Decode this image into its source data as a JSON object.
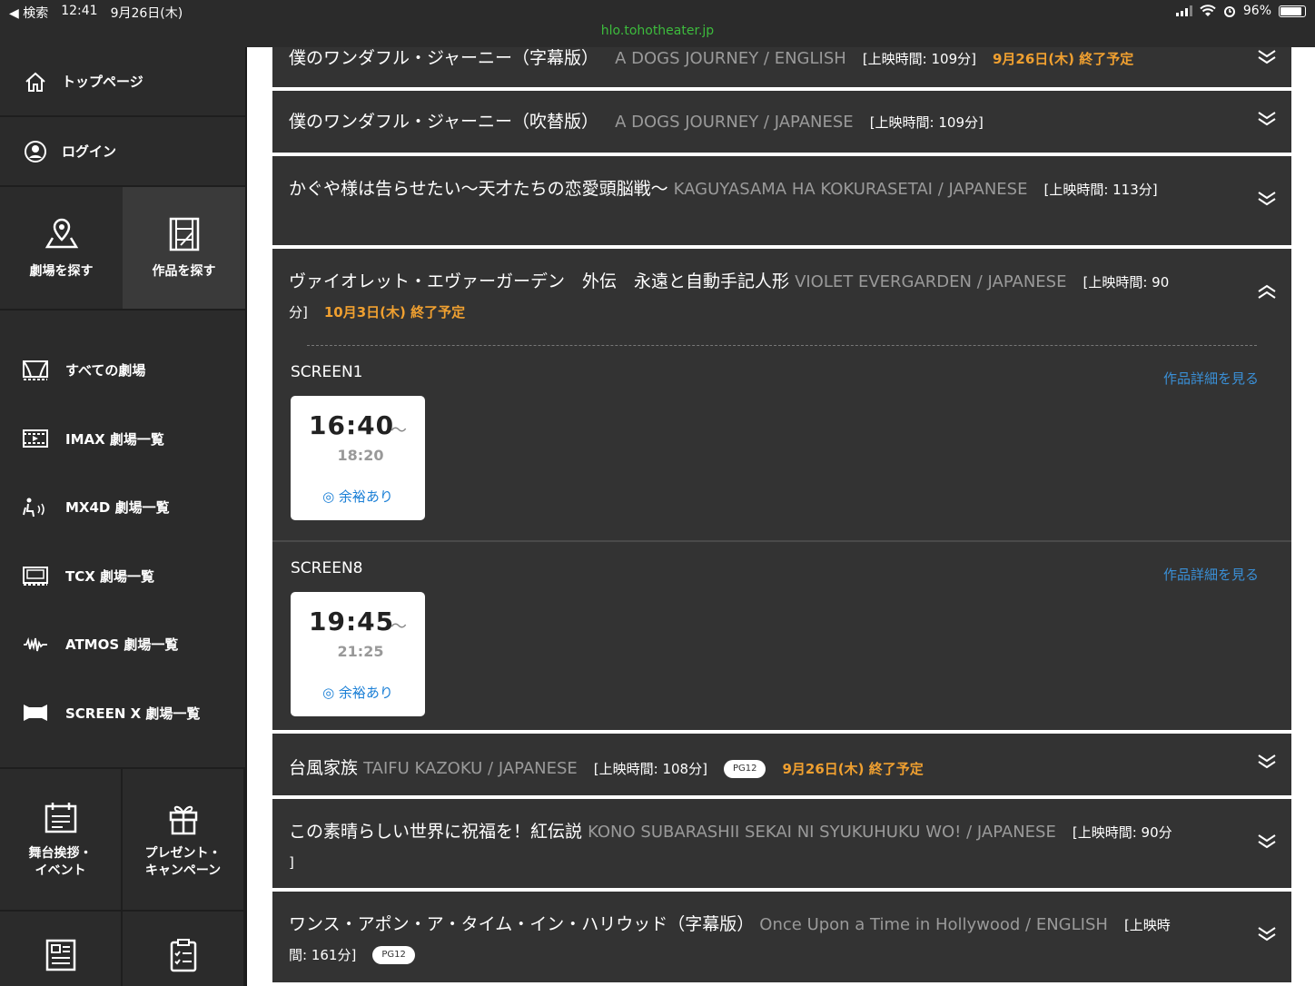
{
  "status": {
    "back": "◀ 検索",
    "time": "12:41",
    "date": "9月26日(木)",
    "battery": "96%",
    "url": "hlo.tohotheater.jp"
  },
  "sidebar": {
    "top_page": "トップページ",
    "login": "ログイン",
    "find_theater": "劇場を探す",
    "find_movie": "作品を探す",
    "items": [
      {
        "label": "すべての劇場",
        "icon": "theater-icon"
      },
      {
        "label": "IMAX 劇場一覧",
        "icon": "imax-icon"
      },
      {
        "label": "MX4D 劇場一覧",
        "icon": "mx4d-icon"
      },
      {
        "label": "TCX 劇場一覧",
        "icon": "tcx-icon"
      },
      {
        "label": "ATMOS 劇場一覧",
        "icon": "atmos-icon"
      },
      {
        "label": "SCREEN X 劇場一覧",
        "icon": "screenx-icon"
      }
    ],
    "event_line1": "舞台挨拶・",
    "event_line2": "イベント",
    "present_line1": "プレゼント・",
    "present_line2": "キャンペーン"
  },
  "movies": [
    {
      "jp": "僕のワンダフル・ジャーニー（字幕版）",
      "en": "A DOGS JOURNEY / ENGLISH",
      "duration": "[上映時間: 109分]",
      "end": "9月26日(木) 終了予定"
    },
    {
      "jp": "僕のワンダフル・ジャーニー（吹替版）",
      "en": "A DOGS JOURNEY / JAPANESE",
      "duration": "[上映時間: 109分]"
    },
    {
      "jp": "かぐや様は告らせたい〜天才たちの恋愛頭脳戦〜",
      "en": "KAGUYASAMA HA KOKURASETAI / JAPANESE",
      "duration": "[上映時間: 113分]"
    },
    {
      "jp": "ヴァイオレット・エヴァーガーデン　外伝　永遠と自動手記人形",
      "en": "VIOLET EVERGARDEN / JAPANESE",
      "duration_a": "[上映時間: 90",
      "duration_b": "分]",
      "end": "10月3日(木) 終了予定",
      "screens": [
        {
          "name": "SCREEN1",
          "start": "16:40",
          "tilde": "〜",
          "finish": "18:20",
          "avail": "◎ 余裕あり",
          "link": "作品詳細を見る"
        },
        {
          "name": "SCREEN8",
          "start": "19:45",
          "tilde": "〜",
          "finish": "21:25",
          "avail": "◎ 余裕あり",
          "link": "作品詳細を見る"
        }
      ]
    },
    {
      "jp": "台風家族",
      "en": "TAIFU KAZOKU / JAPANESE",
      "duration": "[上映時間: 108分]",
      "rating": "PG12",
      "end": "9月26日(木) 終了予定"
    },
    {
      "jp": "この素晴らしい世界に祝福を！紅伝説",
      "en": "KONO SUBARASHII SEKAI NI SYUKUHUKU WO! / JAPANESE",
      "duration_a": "[上映時間: 90分",
      "duration_b": "]"
    },
    {
      "jp": "ワンス・アポン・ア・タイム・イン・ハリウッド（字幕版）",
      "en": "Once Upon a Time in Hollywood / ENGLISH",
      "duration_a": "[上映時",
      "duration_b": "間: 161分]",
      "rating": "PG12"
    }
  ],
  "colors": {
    "panel": "#333333",
    "sidebar": "#2b2b2b",
    "accent_orange": "#f0a030",
    "link_blue": "#3a8fd6",
    "url_green": "#3dbb3d"
  }
}
